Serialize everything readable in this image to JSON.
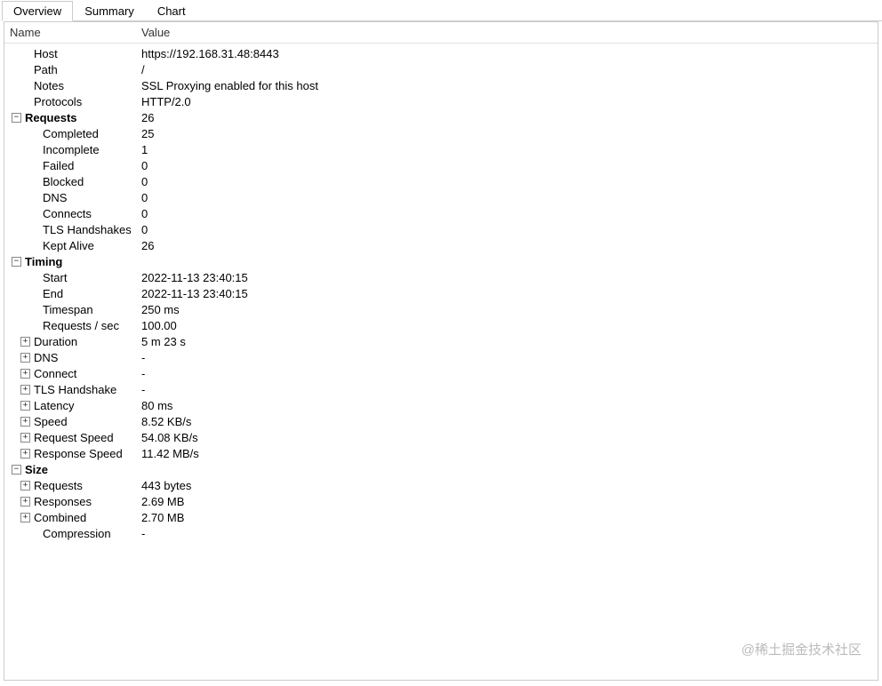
{
  "tabs": {
    "overview": "Overview",
    "summary": "Summary",
    "chart": "Chart"
  },
  "headers": {
    "name": "Name",
    "value": "Value"
  },
  "toggles": {
    "minus": "⊟",
    "plus": "⊞"
  },
  "info": {
    "host_label": "Host",
    "host_value": "https://192.168.31.48:8443",
    "path_label": "Path",
    "path_value": "/",
    "notes_label": "Notes",
    "notes_value": "SSL Proxying enabled for this host",
    "protocols_label": "Protocols",
    "protocols_value": "HTTP/2.0"
  },
  "requests": {
    "title": "Requests",
    "total": "26",
    "completed_label": "Completed",
    "completed_value": "25",
    "incomplete_label": "Incomplete",
    "incomplete_value": "1",
    "failed_label": "Failed",
    "failed_value": "0",
    "blocked_label": "Blocked",
    "blocked_value": "0",
    "dns_label": "DNS",
    "dns_value": "0",
    "connects_label": "Connects",
    "connects_value": "0",
    "tls_label": "TLS Handshakes",
    "tls_value": "0",
    "keptalive_label": "Kept Alive",
    "keptalive_value": "26"
  },
  "timing": {
    "title": "Timing",
    "start_label": "Start",
    "start_value": "2022-11-13 23:40:15",
    "end_label": "End",
    "end_value": "2022-11-13 23:40:15",
    "timespan_label": "Timespan",
    "timespan_value": "250 ms",
    "rps_label": "Requests / sec",
    "rps_value": "100.00",
    "duration_label": "Duration",
    "duration_value": "5 m 23 s",
    "dns_label": "DNS",
    "dns_value": "-",
    "connect_label": "Connect",
    "connect_value": "-",
    "tls_label": "TLS Handshake",
    "tls_value": "-",
    "latency_label": "Latency",
    "latency_value": "80 ms",
    "speed_label": "Speed",
    "speed_value": "8.52 KB/s",
    "reqspeed_label": "Request Speed",
    "reqspeed_value": "54.08 KB/s",
    "respspeed_label": "Response Speed",
    "respspeed_value": "11.42 MB/s"
  },
  "size": {
    "title": "Size",
    "requests_label": "Requests",
    "requests_value": "443 bytes",
    "responses_label": "Responses",
    "responses_value": "2.69 MB",
    "combined_label": "Combined",
    "combined_value": "2.70 MB",
    "compression_label": "Compression",
    "compression_value": "-"
  },
  "watermark": "@稀土掘金技术社区"
}
